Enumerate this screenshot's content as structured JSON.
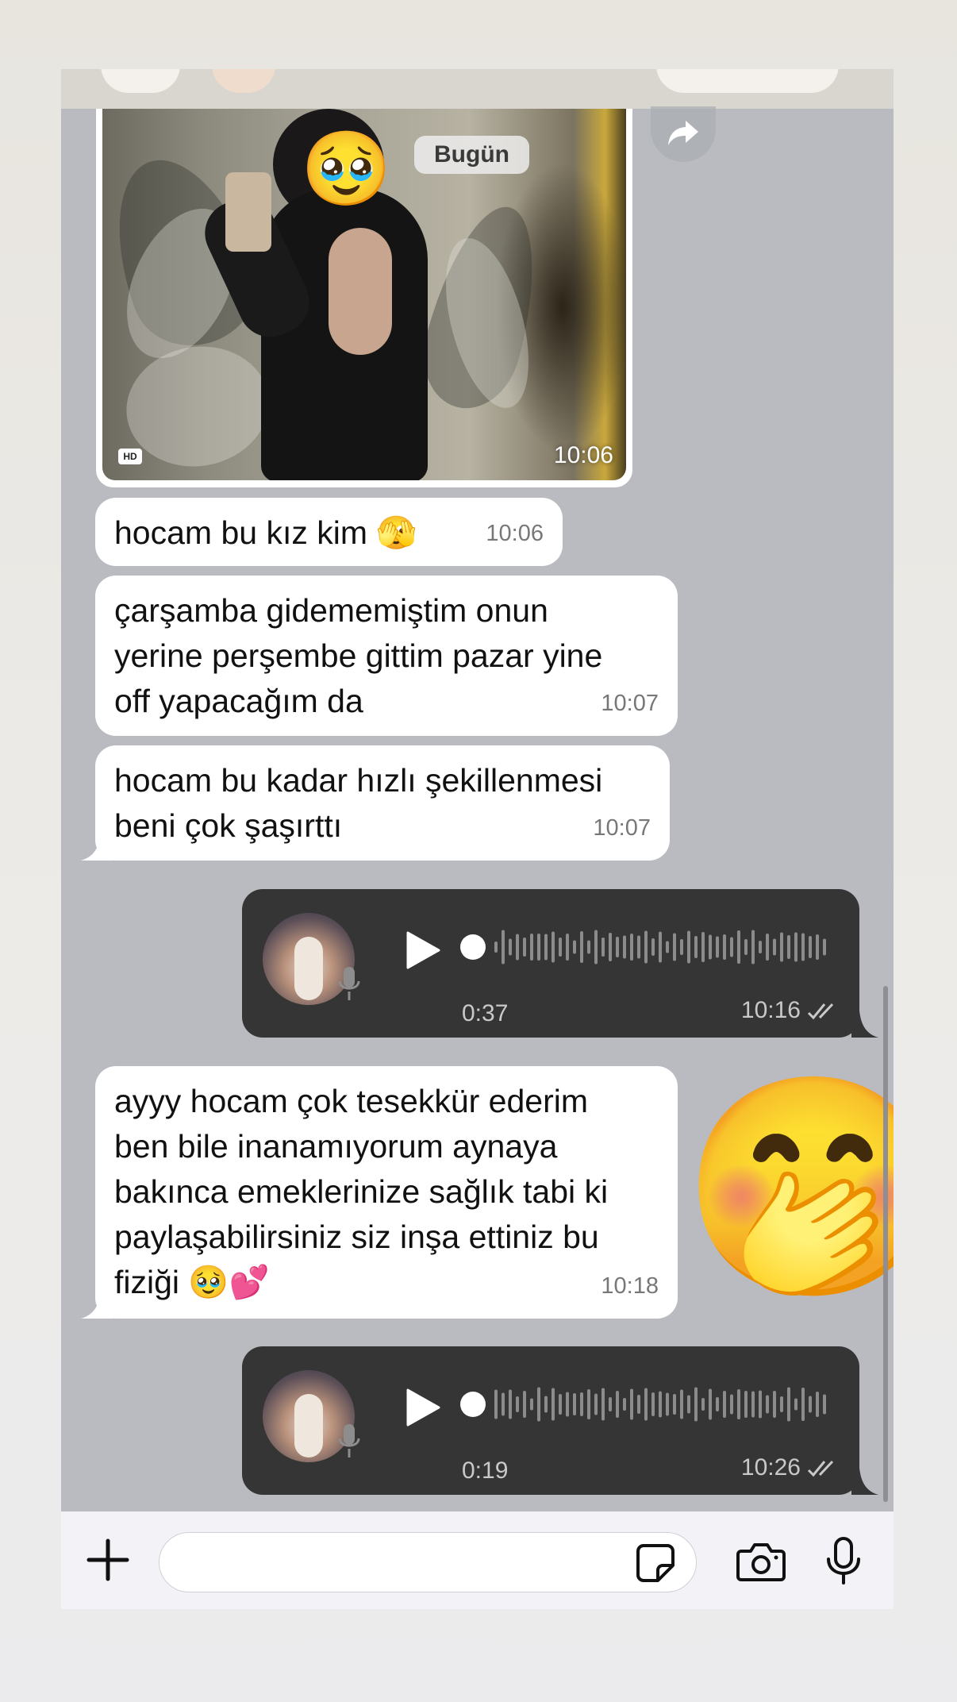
{
  "chat": {
    "date_chip": "Bugün",
    "image_message": {
      "time": "10:06",
      "badge": "HD",
      "overlay_emoji": "🥹"
    },
    "messages": [
      {
        "text": "hocam bu kız kim 🫣",
        "time": "10:06"
      },
      {
        "text": "çarşamba gidememiştim onun\nyerine perşembe gittim pazar yine\noff yapacağım da",
        "time": "10:07"
      },
      {
        "text": "hocam bu kadar hızlı şekillenmesi\nbeni çok şaşırttı",
        "time": "10:07"
      },
      {
        "text": "ayyy hocam çok tesekkür ederim\nben bile inanamıyorum aynaya\nbakınca emeklerinize sağlık tabi ki\npaylaşabilirsiniz siz inşa ettiniz bu\nfiziği 🥹💕",
        "time": "10:18"
      }
    ],
    "voice_messages": [
      {
        "duration": "0:37",
        "time": "10:16",
        "status": "read"
      },
      {
        "duration": "0:19",
        "time": "10:26",
        "status": "read"
      }
    ],
    "sticker_overlay": "🤭"
  },
  "input_bar": {
    "placeholder": "",
    "icons": [
      "plus-icon",
      "sticker-icon",
      "camera-icon",
      "microphone-icon"
    ]
  },
  "colors": {
    "chat_background": "#b9bbc0",
    "incoming_bubble": "#ffffff",
    "outgoing_voice_bubble": "#353535",
    "input_bar": "#f2f2f7"
  }
}
